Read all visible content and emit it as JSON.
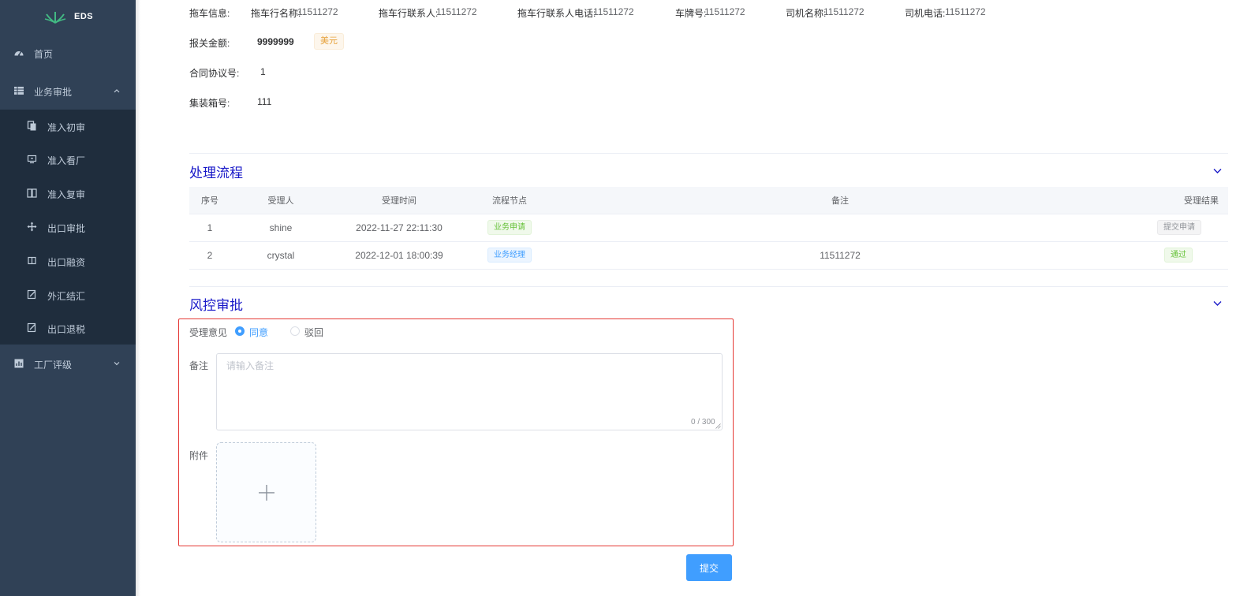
{
  "app": {
    "logo_text": "EDS"
  },
  "sidebar": {
    "items": [
      {
        "label": "首页",
        "icon": "dashboard-icon"
      },
      {
        "label": "业务审批",
        "icon": "table-icon",
        "expanded": true
      },
      {
        "label": "工厂评级",
        "icon": "chart-icon",
        "expanded": false
      }
    ],
    "sub_items": [
      {
        "label": "准入初审",
        "icon": "copy-icon"
      },
      {
        "label": "准入看厂",
        "icon": "monitor-icon"
      },
      {
        "label": "准入复审",
        "icon": "book-icon"
      },
      {
        "label": "出口审批",
        "icon": "move-icon"
      },
      {
        "label": "出口融资",
        "icon": "columns-icon"
      },
      {
        "label": "外汇结汇",
        "icon": "edit-icon"
      },
      {
        "label": "出口退税",
        "icon": "edit-icon"
      }
    ]
  },
  "info": {
    "tow_label": "拖车信息:",
    "tow_company_label": "拖车行名称:",
    "tow_company_value": "11511272",
    "tow_contact_label": "拖车行联系人:",
    "tow_contact_value": "11511272",
    "tow_contact_phone_label": "拖车行联系人电话:",
    "tow_contact_phone_value": "11511272",
    "plate_label": "车牌号:",
    "plate_value": "11511272",
    "driver_name_label": "司机名称:",
    "driver_name_value": "11511272",
    "driver_phone_label": "司机电话:",
    "driver_phone_value": "11511272",
    "customs_amount_label": "报关金额:",
    "customs_amount_value": "9999999",
    "currency": "美元",
    "contract_label": "合同协议号:",
    "contract_value": "1",
    "container_label": "集装箱号:",
    "container_value": "111"
  },
  "process": {
    "title": "处理流程",
    "columns": [
      "序号",
      "受理人",
      "受理时间",
      "流程节点",
      "备注",
      "受理结果"
    ],
    "rows": [
      {
        "no": "1",
        "handler": "shine",
        "time": "2022-11-27 22:11:30",
        "node": "业务申请",
        "node_type": "success",
        "remark": "",
        "result": "提交申请",
        "result_type": "info"
      },
      {
        "no": "2",
        "handler": "crystal",
        "time": "2022-12-01 18:00:39",
        "node": "业务经理",
        "node_type": "primary",
        "remark": "11511272",
        "result": "通过",
        "result_type": "success"
      }
    ]
  },
  "risk": {
    "title": "风控审批",
    "opinion_label": "受理意见",
    "options": [
      {
        "label": "同意",
        "checked": true
      },
      {
        "label": "驳回",
        "checked": false
      }
    ],
    "remark_label": "备注",
    "remark_placeholder": "请输入备注",
    "remark_value": "",
    "counter": "0 / 300",
    "attachment_label": "附件",
    "submit_label": "提交"
  },
  "colors": {
    "primary": "#409eff",
    "sidebar_bg": "#304156",
    "submenu_bg": "#1f2d3d",
    "section_title": "#1818c8",
    "highlight_border": "#e53935"
  }
}
